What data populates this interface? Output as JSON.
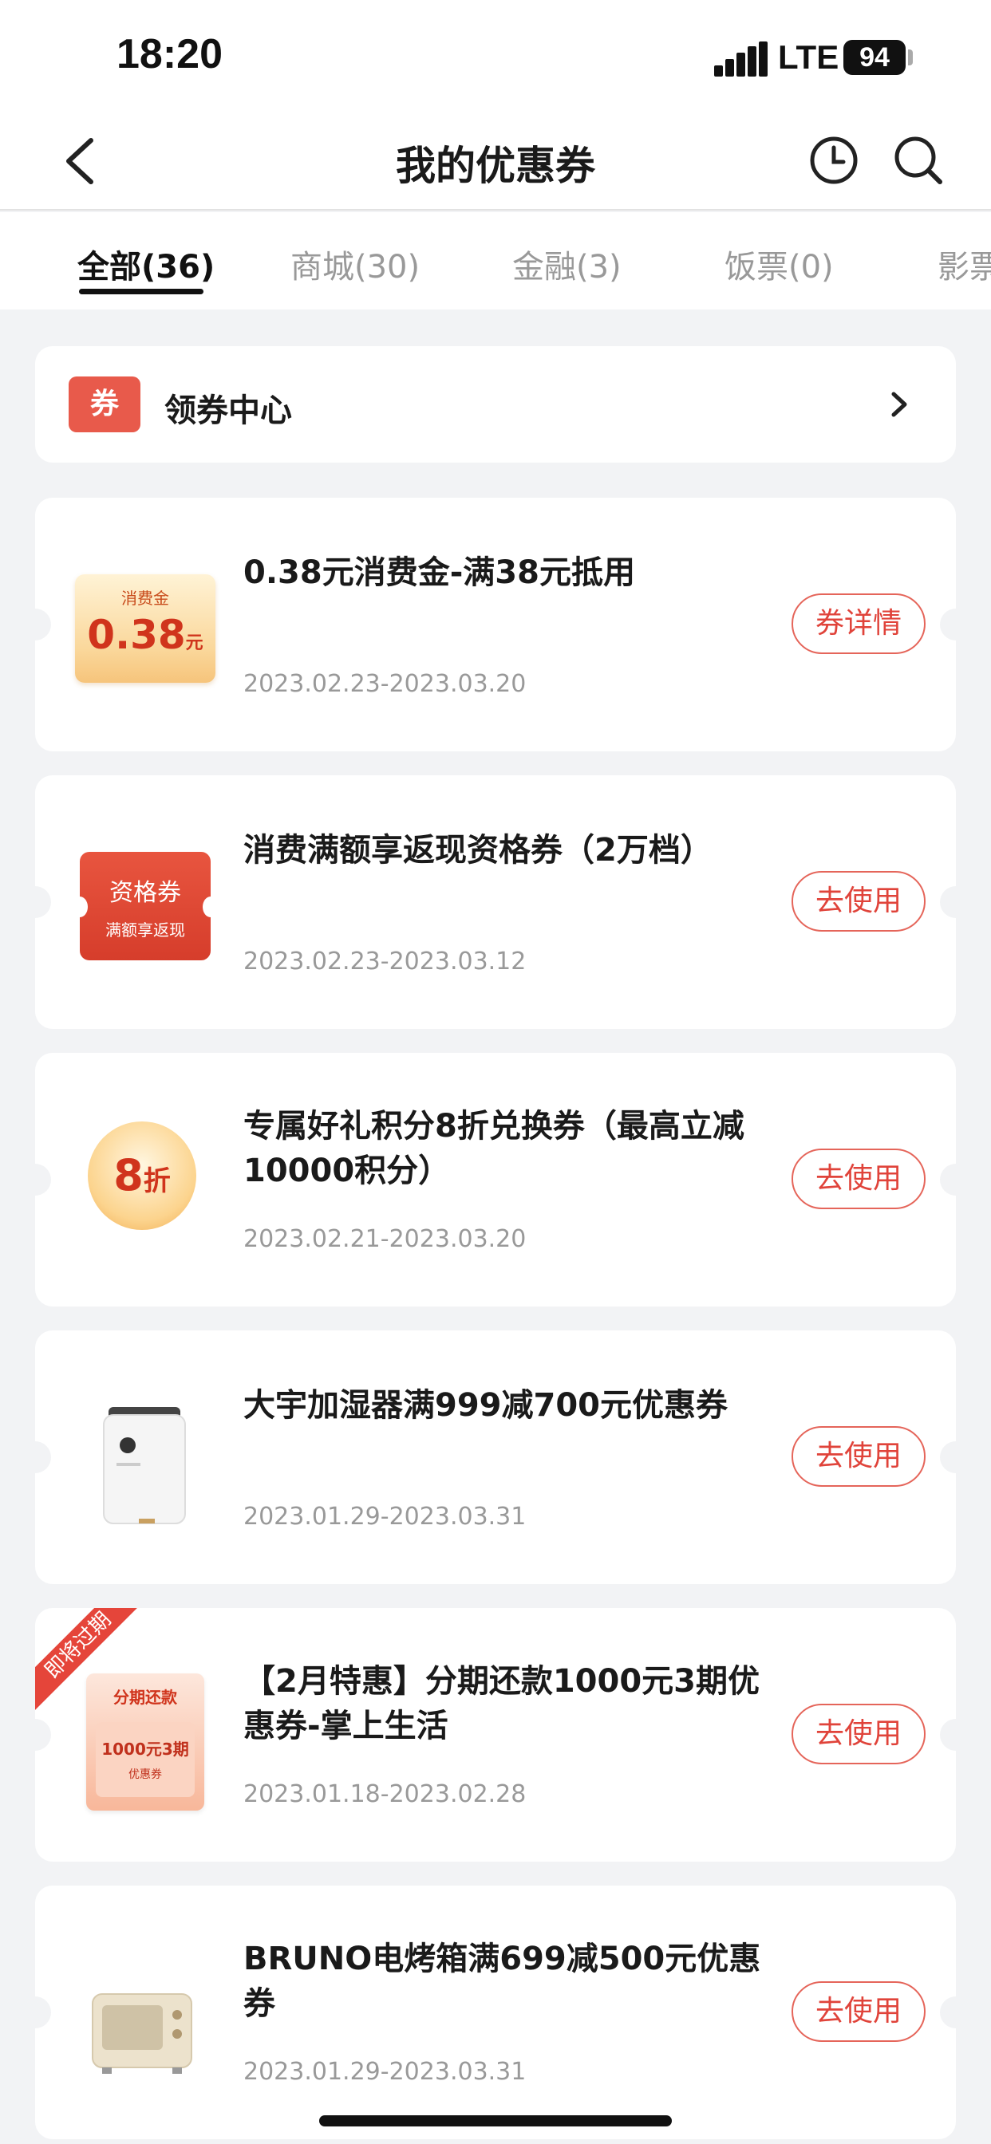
{
  "status_bar": {
    "time": "18:20",
    "network": "LTE",
    "battery": "94"
  },
  "header": {
    "title": "我的优惠券",
    "icons": [
      "back-arrow-icon",
      "clock-icon",
      "search-icon"
    ]
  },
  "tabs": [
    {
      "label": "全部(36)",
      "active": true
    },
    {
      "label": "商城(30)",
      "active": false
    },
    {
      "label": "金融(3)",
      "active": false
    },
    {
      "label": "饭票(0)",
      "active": false
    },
    {
      "label": "影票",
      "active": false
    }
  ],
  "coupon_center": {
    "badge": "券",
    "label": "领券中心"
  },
  "coupons": [
    {
      "title": "0.38元消费金-满38元抵用",
      "date": "2023.02.23-2023.03.20",
      "button": "券详情",
      "thumb": {
        "top": "消费金",
        "amount": "0.38",
        "unit": "元"
      }
    },
    {
      "title": "消费满额享返现资格券（2万档）",
      "date": "2023.02.23-2023.03.12",
      "button": "去使用",
      "thumb": {
        "top": "资格券",
        "sub": "满额享返现"
      }
    },
    {
      "title": "专属好礼积分8折兑换券（最高立减10000积分）",
      "date": "2023.02.21-2023.03.20",
      "button": "去使用",
      "thumb": {
        "amount": "8",
        "unit": "折"
      }
    },
    {
      "title": "大宇加湿器满999减700元优惠券",
      "date": "2023.01.29-2023.03.31",
      "button": "去使用",
      "thumb": {
        "image": "humidifier"
      }
    },
    {
      "title": "【2月特惠】分期还款1000元3期优惠券-掌上生活",
      "date": "2023.01.18-2023.02.28",
      "button": "去使用",
      "ribbon": "即将过期",
      "thumb": {
        "top": "分期还款",
        "amount": "1000元3期",
        "sub": "优惠券"
      }
    },
    {
      "title": "BRUNO电烤箱满699减500元优惠券",
      "date": "2023.01.29-2023.03.31",
      "button": "去使用",
      "thumb": {
        "image": "oven"
      }
    }
  ],
  "colors": {
    "accent": "#e0433a",
    "background": "#f2f3f5",
    "badge": "#e85a4b"
  }
}
